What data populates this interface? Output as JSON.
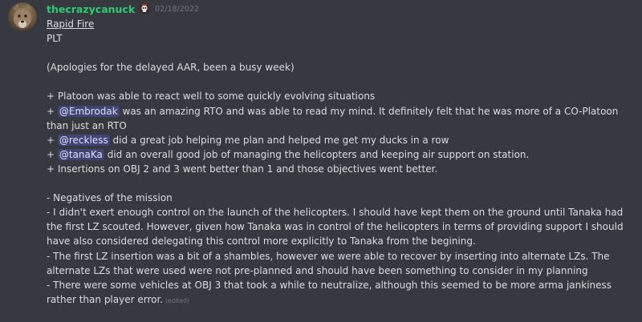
{
  "message": {
    "author": "thecrazycanuck",
    "badge_icon": "skull-badge-icon",
    "timestamp": "02/18/2022",
    "edited_label": "(edited)",
    "title": "Rapid Fire",
    "subtitle": "PLT",
    "apology": "(Apologies for the delayed AAR, been a busy week)",
    "positives": {
      "p1": "+ Platoon was able to react well to some quickly evolving situations",
      "p2_prefix": "+ ",
      "p2_mention": "@Embrodak",
      "p2_text": " was an amazing RTO and was able to read my mind. It definitely felt that he was more of a CO-Platoon than just an RTO",
      "p3_prefix": "+ ",
      "p3_mention": "@reckless",
      "p3_text": " did a great job helping me plan and helped me get my ducks in a row",
      "p4_prefix": "+ ",
      "p4_mention": "@tanaKa",
      "p4_text": " did an overall good job of managing the helicopters and keeping air support on station.",
      "p5": "+ Insertions on OBJ 2 and 3 went better than 1 and those objectives went better."
    },
    "negatives": {
      "heading": "- Negatives of the mission",
      "n1": "- I didn't exert enough control on the launch of the helicopters. I should have kept them on the ground until Tanaka had the first LZ scouted. However, given how Tanaka was in control of the helicopters in terms of providing support I should have also considered delegating this control more explicitly to Tanaka from the begining.",
      "n2": "- The first LZ insertion was a bit of a shambles, however we were able to recover by inserting into alternate LZs. The alternate LZs that were used were not pre-planned and should have been something to consider in my planning",
      "n3": "- There were some vehicles at OBJ 3 that took a while to neutralize, although this seemed to be more arma jankiness rather than player error."
    }
  },
  "colors": {
    "background": "#36393f",
    "username": "#2ecc71",
    "text": "#dcddde",
    "timestamp": "#72767d",
    "mention_bg": "#4b538a"
  }
}
